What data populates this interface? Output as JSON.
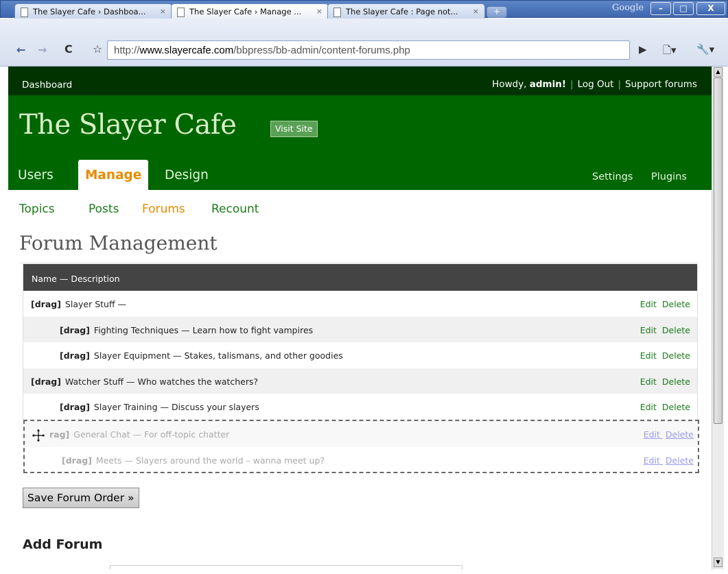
{
  "browser": {
    "tabs": [
      {
        "label": "The Slayer Cafe › Dashboa...",
        "active": false
      },
      {
        "label": "The Slayer Cafe › Manage ...",
        "active": true
      },
      {
        "label": "The Slayer Cafe : Page not...",
        "active": false
      }
    ],
    "google_label": "Google",
    "url_prefix": "http://",
    "url_host": "www.slayercafe.com",
    "url_path": "/bbpress/bb-admin/content-forums.php",
    "new_tab_symbol": "+",
    "close_symbol": "×"
  },
  "adminbar": {
    "dashboard": "Dashboard",
    "howdy_prefix": "Howdy, ",
    "howdy_user": "admin!",
    "logout": "Log Out",
    "support": "Support forums",
    "separator": "|"
  },
  "header": {
    "site_title": "The Slayer Cafe",
    "visit_site": "Visit Site"
  },
  "main_nav": {
    "users": "Users",
    "manage": "Manage",
    "design": "Design",
    "settings": "Settings",
    "plugins": "Plugins"
  },
  "sub_nav": {
    "topics": "Topics",
    "posts": "Posts",
    "forums": "Forums",
    "recount": "Recount"
  },
  "page_title": "Forum Management",
  "table": {
    "header": "Name — Description",
    "drag_label": "[drag]",
    "edit": "Edit",
    "delete": "Delete",
    "rows": [
      {
        "text": "Slayer Stuff —",
        "level": 0
      },
      {
        "text": "Fighting Techniques — Learn how to fight vampires",
        "level": 1
      },
      {
        "text": "Slayer Equipment — Stakes, talismans, and other goodies",
        "level": 1
      },
      {
        "text": "Watcher Stuff — Who watches the watchers?",
        "level": 0
      },
      {
        "text": "Slayer Training — Discuss your slayers",
        "level": 1
      }
    ],
    "ghost_rows": [
      {
        "drag": "rag]",
        "text": "General Chat — For off-topic chatter",
        "level": 0
      },
      {
        "drag": "[drag]",
        "text": "Meets — Slayers around the world – wanna meet up?",
        "level": 1
      }
    ]
  },
  "save_button": "Save Forum Order »",
  "add_forum_heading": "Add Forum"
}
